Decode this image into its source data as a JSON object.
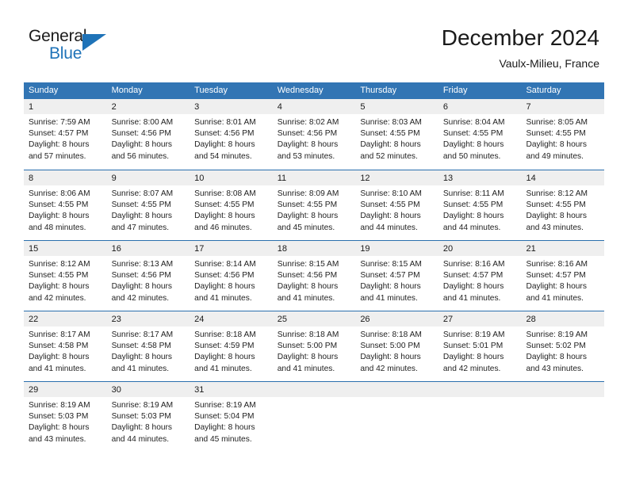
{
  "brand": {
    "word_one": "General",
    "word_two": "Blue",
    "logo_icon": "triangle-logo-icon",
    "accent_color": "#1f73b8"
  },
  "header": {
    "title": "December 2024",
    "location": "Vaulx-Milieu, France"
  },
  "theme": {
    "header_blue": "#3275b4",
    "row_divider_blue": "#2a6fad",
    "day_band_gray": "#efefef"
  },
  "weekdays": [
    "Sunday",
    "Monday",
    "Tuesday",
    "Wednesday",
    "Thursday",
    "Friday",
    "Saturday"
  ],
  "weeks": [
    [
      {
        "day": "1",
        "lines": [
          "Sunrise: 7:59 AM",
          "Sunset: 4:57 PM",
          "Daylight: 8 hours",
          "and 57 minutes."
        ]
      },
      {
        "day": "2",
        "lines": [
          "Sunrise: 8:00 AM",
          "Sunset: 4:56 PM",
          "Daylight: 8 hours",
          "and 56 minutes."
        ]
      },
      {
        "day": "3",
        "lines": [
          "Sunrise: 8:01 AM",
          "Sunset: 4:56 PM",
          "Daylight: 8 hours",
          "and 54 minutes."
        ]
      },
      {
        "day": "4",
        "lines": [
          "Sunrise: 8:02 AM",
          "Sunset: 4:56 PM",
          "Daylight: 8 hours",
          "and 53 minutes."
        ]
      },
      {
        "day": "5",
        "lines": [
          "Sunrise: 8:03 AM",
          "Sunset: 4:55 PM",
          "Daylight: 8 hours",
          "and 52 minutes."
        ]
      },
      {
        "day": "6",
        "lines": [
          "Sunrise: 8:04 AM",
          "Sunset: 4:55 PM",
          "Daylight: 8 hours",
          "and 50 minutes."
        ]
      },
      {
        "day": "7",
        "lines": [
          "Sunrise: 8:05 AM",
          "Sunset: 4:55 PM",
          "Daylight: 8 hours",
          "and 49 minutes."
        ]
      }
    ],
    [
      {
        "day": "8",
        "lines": [
          "Sunrise: 8:06 AM",
          "Sunset: 4:55 PM",
          "Daylight: 8 hours",
          "and 48 minutes."
        ]
      },
      {
        "day": "9",
        "lines": [
          "Sunrise: 8:07 AM",
          "Sunset: 4:55 PM",
          "Daylight: 8 hours",
          "and 47 minutes."
        ]
      },
      {
        "day": "10",
        "lines": [
          "Sunrise: 8:08 AM",
          "Sunset: 4:55 PM",
          "Daylight: 8 hours",
          "and 46 minutes."
        ]
      },
      {
        "day": "11",
        "lines": [
          "Sunrise: 8:09 AM",
          "Sunset: 4:55 PM",
          "Daylight: 8 hours",
          "and 45 minutes."
        ]
      },
      {
        "day": "12",
        "lines": [
          "Sunrise: 8:10 AM",
          "Sunset: 4:55 PM",
          "Daylight: 8 hours",
          "and 44 minutes."
        ]
      },
      {
        "day": "13",
        "lines": [
          "Sunrise: 8:11 AM",
          "Sunset: 4:55 PM",
          "Daylight: 8 hours",
          "and 44 minutes."
        ]
      },
      {
        "day": "14",
        "lines": [
          "Sunrise: 8:12 AM",
          "Sunset: 4:55 PM",
          "Daylight: 8 hours",
          "and 43 minutes."
        ]
      }
    ],
    [
      {
        "day": "15",
        "lines": [
          "Sunrise: 8:12 AM",
          "Sunset: 4:55 PM",
          "Daylight: 8 hours",
          "and 42 minutes."
        ]
      },
      {
        "day": "16",
        "lines": [
          "Sunrise: 8:13 AM",
          "Sunset: 4:56 PM",
          "Daylight: 8 hours",
          "and 42 minutes."
        ]
      },
      {
        "day": "17",
        "lines": [
          "Sunrise: 8:14 AM",
          "Sunset: 4:56 PM",
          "Daylight: 8 hours",
          "and 41 minutes."
        ]
      },
      {
        "day": "18",
        "lines": [
          "Sunrise: 8:15 AM",
          "Sunset: 4:56 PM",
          "Daylight: 8 hours",
          "and 41 minutes."
        ]
      },
      {
        "day": "19",
        "lines": [
          "Sunrise: 8:15 AM",
          "Sunset: 4:57 PM",
          "Daylight: 8 hours",
          "and 41 minutes."
        ]
      },
      {
        "day": "20",
        "lines": [
          "Sunrise: 8:16 AM",
          "Sunset: 4:57 PM",
          "Daylight: 8 hours",
          "and 41 minutes."
        ]
      },
      {
        "day": "21",
        "lines": [
          "Sunrise: 8:16 AM",
          "Sunset: 4:57 PM",
          "Daylight: 8 hours",
          "and 41 minutes."
        ]
      }
    ],
    [
      {
        "day": "22",
        "lines": [
          "Sunrise: 8:17 AM",
          "Sunset: 4:58 PM",
          "Daylight: 8 hours",
          "and 41 minutes."
        ]
      },
      {
        "day": "23",
        "lines": [
          "Sunrise: 8:17 AM",
          "Sunset: 4:58 PM",
          "Daylight: 8 hours",
          "and 41 minutes."
        ]
      },
      {
        "day": "24",
        "lines": [
          "Sunrise: 8:18 AM",
          "Sunset: 4:59 PM",
          "Daylight: 8 hours",
          "and 41 minutes."
        ]
      },
      {
        "day": "25",
        "lines": [
          "Sunrise: 8:18 AM",
          "Sunset: 5:00 PM",
          "Daylight: 8 hours",
          "and 41 minutes."
        ]
      },
      {
        "day": "26",
        "lines": [
          "Sunrise: 8:18 AM",
          "Sunset: 5:00 PM",
          "Daylight: 8 hours",
          "and 42 minutes."
        ]
      },
      {
        "day": "27",
        "lines": [
          "Sunrise: 8:19 AM",
          "Sunset: 5:01 PM",
          "Daylight: 8 hours",
          "and 42 minutes."
        ]
      },
      {
        "day": "28",
        "lines": [
          "Sunrise: 8:19 AM",
          "Sunset: 5:02 PM",
          "Daylight: 8 hours",
          "and 43 minutes."
        ]
      }
    ],
    [
      {
        "day": "29",
        "lines": [
          "Sunrise: 8:19 AM",
          "Sunset: 5:03 PM",
          "Daylight: 8 hours",
          "and 43 minutes."
        ]
      },
      {
        "day": "30",
        "lines": [
          "Sunrise: 8:19 AM",
          "Sunset: 5:03 PM",
          "Daylight: 8 hours",
          "and 44 minutes."
        ]
      },
      {
        "day": "31",
        "lines": [
          "Sunrise: 8:19 AM",
          "Sunset: 5:04 PM",
          "Daylight: 8 hours",
          "and 45 minutes."
        ]
      },
      {
        "day": "",
        "lines": []
      },
      {
        "day": "",
        "lines": []
      },
      {
        "day": "",
        "lines": []
      },
      {
        "day": "",
        "lines": []
      }
    ]
  ]
}
